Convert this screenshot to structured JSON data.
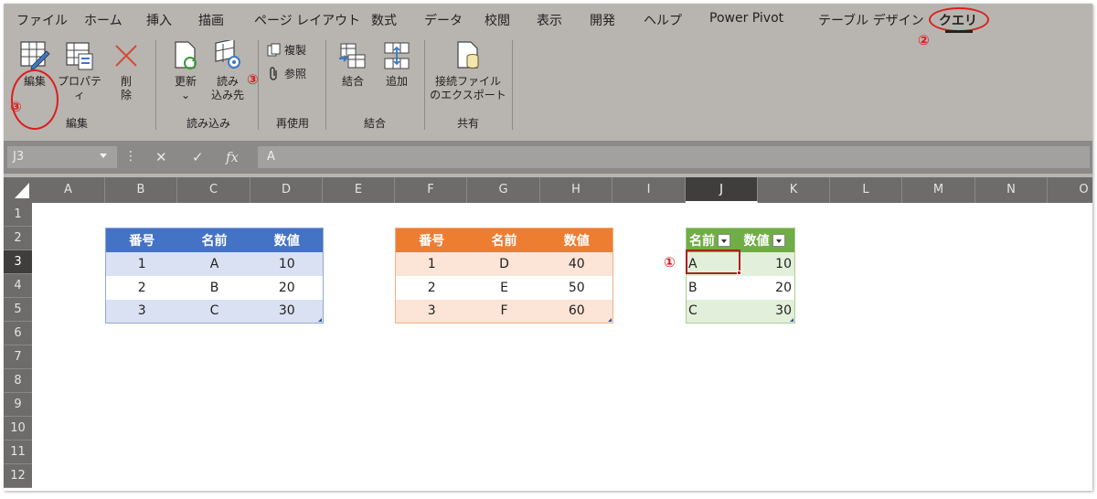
{
  "ribbon_tabs": [
    "ファイル",
    "ホーム",
    "挿入",
    "描画",
    "ページ レイアウト",
    "数式",
    "データ",
    "校閲",
    "表示",
    "開発",
    "ヘルプ",
    "Power Pivot",
    "テーブル デザイン",
    "クエリ"
  ],
  "active_tab": "クエリ",
  "annotations": {
    "one": "①",
    "two": "②",
    "three": "③"
  },
  "ribbon": {
    "edit_group": {
      "label": "編集",
      "edit": "編集",
      "properties": "プロパティ",
      "delete_line1": "削",
      "delete_line2": "除"
    },
    "load_group": {
      "label": "読み込み",
      "refresh": "更新",
      "refresh_arrow": "⌄",
      "load_to_line1": "読み",
      "load_to_line2": "込み先"
    },
    "reuse_group": {
      "label": "再使用",
      "duplicate": "複製",
      "reference": "参照"
    },
    "combine_group": {
      "label": "結合",
      "merge": "結合",
      "append": "追加"
    },
    "share_group": {
      "label": "共有",
      "export_line1": "接続ファイル",
      "export_line2": "のエクスポート"
    }
  },
  "formula_bar": {
    "name_box": "J3",
    "cancel": "✕",
    "enter": "✓",
    "fx": "fx",
    "value": "A"
  },
  "column_headers": [
    "A",
    "B",
    "C",
    "D",
    "E",
    "F",
    "G",
    "H",
    "I",
    "J",
    "K",
    "L",
    "M",
    "N",
    "O"
  ],
  "row_headers": [
    "1",
    "2",
    "3",
    "4",
    "5",
    "6",
    "7",
    "8",
    "9",
    "10",
    "11",
    "12"
  ],
  "selected_cell": "J3",
  "table_blue": {
    "headers": [
      "番号",
      "名前",
      "数値"
    ],
    "rows": [
      [
        "1",
        "A",
        "10"
      ],
      [
        "2",
        "B",
        "20"
      ],
      [
        "3",
        "C",
        "30"
      ]
    ],
    "color": "#4472c4"
  },
  "table_orange": {
    "headers": [
      "番号",
      "名前",
      "数値"
    ],
    "rows": [
      [
        "1",
        "D",
        "40"
      ],
      [
        "2",
        "E",
        "50"
      ],
      [
        "3",
        "F",
        "60"
      ]
    ],
    "color": "#ed7d31"
  },
  "table_green": {
    "headers": [
      "名前",
      "数値"
    ],
    "rows": [
      [
        "A",
        "10"
      ],
      [
        "B",
        "20"
      ],
      [
        "C",
        "30"
      ]
    ],
    "color": "#70ad47"
  }
}
